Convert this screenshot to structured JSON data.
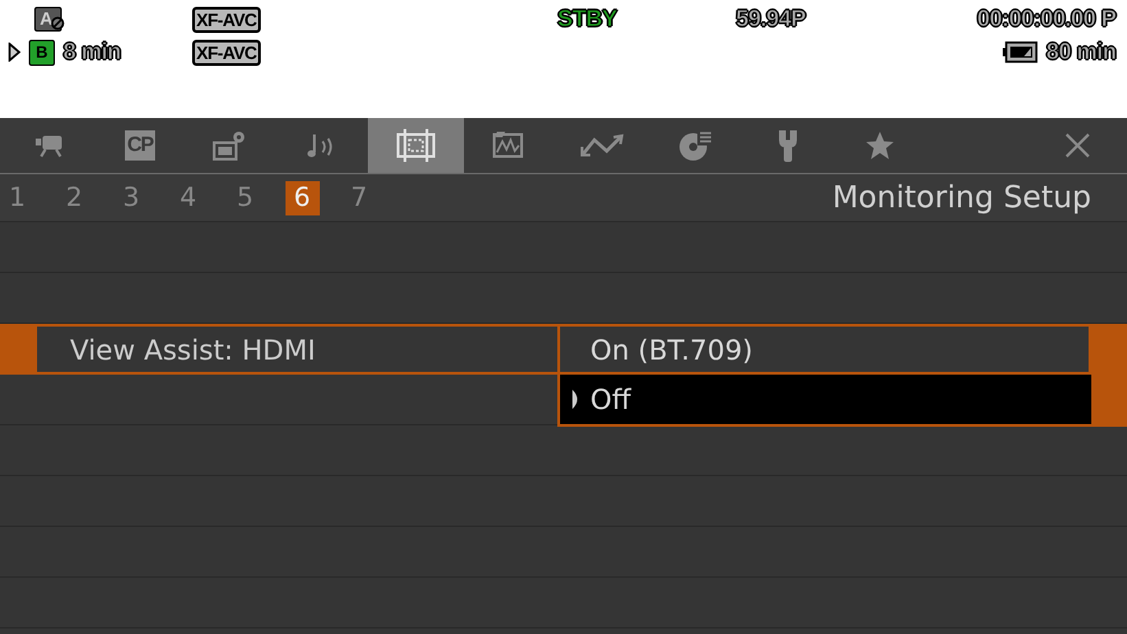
{
  "osd": {
    "slot_a_icon": "A",
    "slot_b": {
      "label": "B",
      "selected": true
    },
    "remaining": "8 min",
    "formats": [
      "XF-AVC",
      "XF-AVC"
    ],
    "status": "STBY",
    "frame_rate": "59.94P",
    "timecode": "00:00:00.00 P",
    "battery": "80 min"
  },
  "tabs": [
    {
      "kind": "camera",
      "selected": false
    },
    {
      "kind": "text",
      "label": "CP",
      "selected": false
    },
    {
      "kind": "gear-film",
      "selected": false
    },
    {
      "kind": "audio",
      "selected": false
    },
    {
      "kind": "film",
      "selected": true
    },
    {
      "kind": "waveform",
      "selected": false
    },
    {
      "kind": "zigzag",
      "selected": false
    },
    {
      "kind": "disc",
      "selected": false
    },
    {
      "kind": "wrench",
      "selected": false
    },
    {
      "kind": "star",
      "selected": false
    },
    {
      "kind": "close",
      "selected": false
    }
  ],
  "pages": [
    {
      "label": "1",
      "selected": false
    },
    {
      "label": "2",
      "selected": false
    },
    {
      "label": "3",
      "selected": false
    },
    {
      "label": "4",
      "selected": false
    },
    {
      "label": "5",
      "selected": false
    },
    {
      "label": "6",
      "selected": true
    },
    {
      "label": "7",
      "selected": false
    }
  ],
  "page_title": "Monitoring Setup",
  "menu_item": {
    "label": "View Assist: HDMI"
  },
  "options": [
    {
      "label": "On (BT.709)",
      "selected": false
    },
    {
      "label": "Off",
      "selected": true
    }
  ]
}
